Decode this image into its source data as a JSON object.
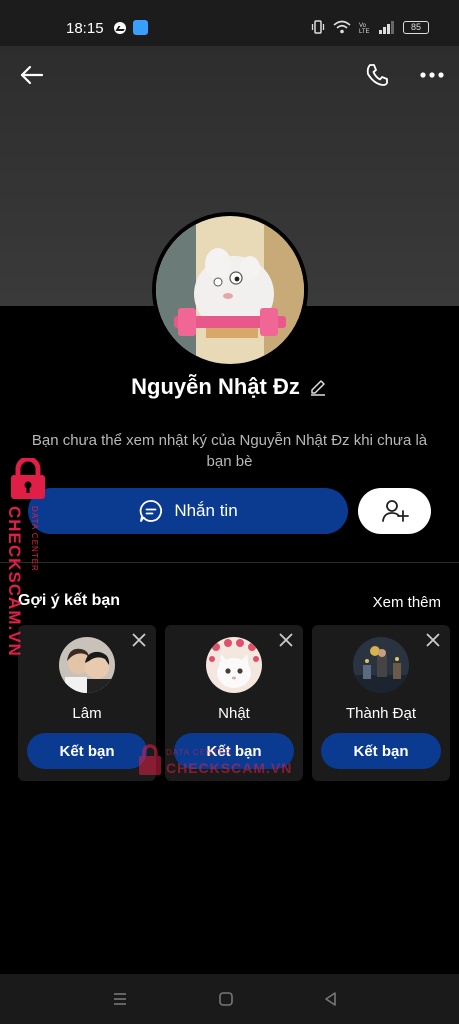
{
  "status_bar": {
    "time": "18:15",
    "battery": "85"
  },
  "profile": {
    "name": "Nguyễn Nhật Đz",
    "privacy_note": "Bạn chưa thể xem nhật ký của Nguyễn Nhật Đz khi chưa là bạn bè"
  },
  "actions": {
    "message_label": "Nhắn tin"
  },
  "suggestions": {
    "title": "Gợi ý kết bạn",
    "see_more": "Xem thêm",
    "items": [
      {
        "name": "Lâm",
        "button": "Kết bạn"
      },
      {
        "name": "Nhật",
        "button": "Kết bạn"
      },
      {
        "name": "Thành Đạt",
        "button": "Kết bạn"
      }
    ]
  },
  "watermark": {
    "text": "CHECKSCAM.VN",
    "subtext": "DATA CENTER"
  },
  "icons": [
    "back-arrow-icon",
    "phone-icon",
    "more-icon",
    "edit-icon",
    "chat-bubble-icon",
    "add-friend-icon",
    "close-icon",
    "lock-icon",
    "menu-icon",
    "home-square-icon",
    "back-triangle-icon"
  ],
  "colors": {
    "accent": "#0a3b91",
    "watermark": "#e01f46",
    "background": "#000000"
  }
}
